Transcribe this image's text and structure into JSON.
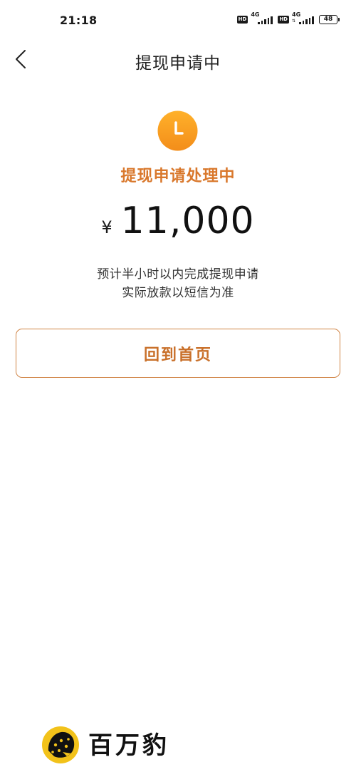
{
  "status_bar": {
    "time": "21:18",
    "hd_badge_1": "HD",
    "network_1": "4G",
    "hd_badge_2": "HD",
    "network_2": "4G",
    "battery": "48"
  },
  "nav": {
    "back_icon": "chevron-left-icon",
    "title": "提现申请中"
  },
  "status": {
    "icon": "clock-icon",
    "title": "提现申请处理中",
    "currency": "¥",
    "amount": "11,000",
    "note_line_1": "预计半小时以内完成提现申请",
    "note_line_2": "实际放款以短信为准"
  },
  "actions": {
    "home_label": "回到首页"
  },
  "watermark": {
    "text": "百万豹"
  },
  "colors": {
    "accent": "#d9782c",
    "button_border": "#d08445",
    "clock_gradient_top": "#ffb12a",
    "clock_gradient_bottom": "#f38d1a"
  }
}
